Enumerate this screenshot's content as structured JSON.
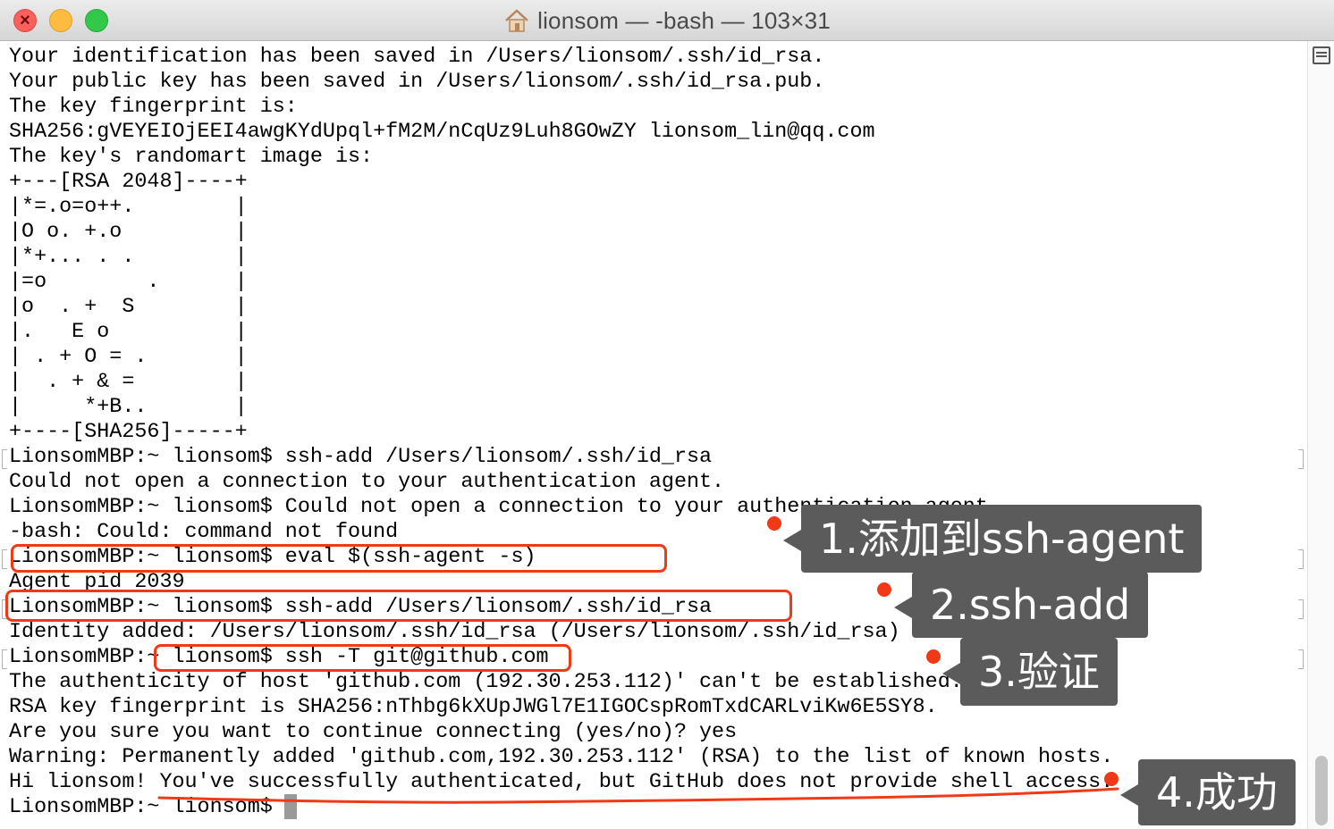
{
  "window": {
    "title": "lionsom — -bash — 103×31"
  },
  "terminal": {
    "lines": [
      "Your identification has been saved in /Users/lionsom/.ssh/id_rsa.",
      "Your public key has been saved in /Users/lionsom/.ssh/id_rsa.pub.",
      "The key fingerprint is:",
      "SHA256:gVEYEIOjEEI4awgKYdUpql+fM2M/nCqUz9Luh8GOwZY lionsom_lin@qq.com",
      "The key's randomart image is:",
      "+---[RSA 2048]----+",
      "|*=.o=o++.        |",
      "|O o. +.o         |",
      "|*+... . .        |",
      "|=o        .      |",
      "|o  . +  S        |",
      "|.   E o          |",
      "| . + O = .       |",
      "|  . + & =        |",
      "|     *+B..       |",
      "+----[SHA256]-----+",
      "LionsomMBP:~ lionsom$ ssh-add /Users/lionsom/.ssh/id_rsa",
      "Could not open a connection to your authentication agent.",
      "LionsomMBP:~ lionsom$ Could not open a connection to your authentication agent.",
      "-bash: Could: command not found",
      "LionsomMBP:~ lionsom$ eval $(ssh-agent -s)",
      "Agent pid 2039",
      "LionsomMBP:~ lionsom$ ssh-add /Users/lionsom/.ssh/id_rsa",
      "Identity added: /Users/lionsom/.ssh/id_rsa (/Users/lionsom/.ssh/id_rsa)",
      "LionsomMBP:~ lionsom$ ssh -T git@github.com",
      "The authenticity of host 'github.com (192.30.253.112)' can't be established.",
      "RSA key fingerprint is SHA256:nThbg6kXUpJWGl7E1IGOCspRomTxdCARLviKw6E5SY8.",
      "Are you sure you want to continue connecting (yes/no)? yes",
      "Warning: Permanently added 'github.com,192.30.253.112' (RSA) to the list of known hosts.",
      "Hi lionsom! You've successfully authenticated, but GitHub does not provide shell access.",
      "LionsomMBP:~ lionsom$ "
    ]
  },
  "annotations": {
    "step1": "1.添加到ssh-agent",
    "step2": "2.ssh-add",
    "step3": "3.验证",
    "step4": "4.成功",
    "color": "#f03a17"
  },
  "icons": {
    "close": "close-icon",
    "minimize": "minimize-icon",
    "maximize": "maximize-icon",
    "home": "home-icon",
    "scroll_toggle": "scrollbar-toggle-icon"
  },
  "colors": {
    "callout_bg": "#5b5b5b",
    "terminal_bg": "#ffffff",
    "text": "#000000"
  }
}
